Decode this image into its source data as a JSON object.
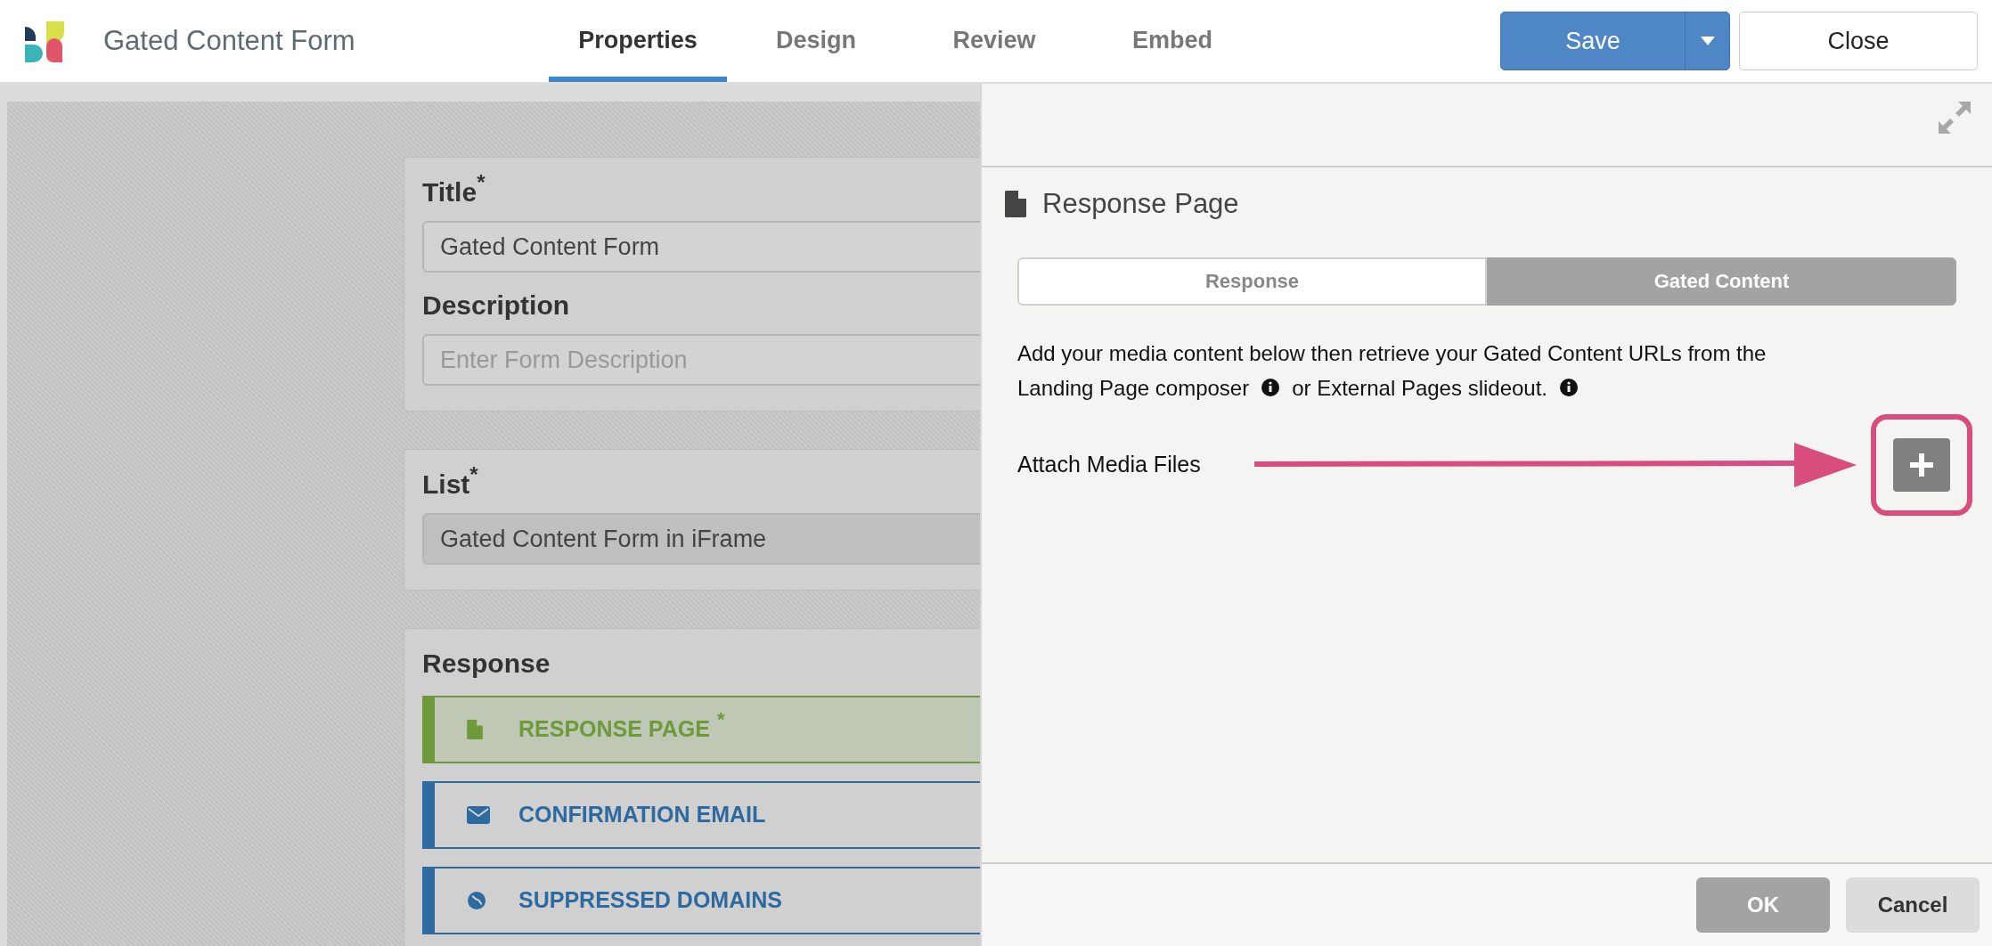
{
  "header": {
    "title": "Gated Content Form",
    "tabs": [
      {
        "label": "Properties",
        "selected": true
      },
      {
        "label": "Design",
        "selected": false
      },
      {
        "label": "Review",
        "selected": false
      },
      {
        "label": "Embed",
        "selected": false
      }
    ],
    "save": "Save",
    "close": "Close"
  },
  "form": {
    "cards": [
      {
        "kind": "fields",
        "fields": [
          {
            "label": "Title",
            "required_mark": "*",
            "value": "Gated Content Form",
            "disabled": false
          },
          {
            "label": "Description",
            "placeholder": "Enter Form Description",
            "disabled": false
          }
        ]
      },
      {
        "kind": "fields",
        "fields": [
          {
            "label": "List",
            "required_mark": "*",
            "value": "Gated Content Form in iFrame",
            "disabled": true
          }
        ]
      },
      {
        "kind": "items",
        "title": "Response",
        "items": [
          {
            "label": "RESPONSE PAGE",
            "required_mark": "*",
            "kind": "page",
            "color": "#6e9a3c",
            "selected": true
          },
          {
            "label": "CONFIRMATION EMAIL",
            "kind": "email",
            "color": "#2c6aa0",
            "selected": false
          },
          {
            "label": "SUPPRESSED DOMAINS",
            "kind": "domains",
            "color": "#2c6aa0",
            "selected": false
          }
        ]
      }
    ]
  },
  "panel": {
    "title": "Response Page",
    "segments": [
      {
        "label": "Response",
        "selected": false
      },
      {
        "label": "Gated Content",
        "selected": true
      }
    ],
    "description": [
      [
        {
          "kind": "text",
          "text": "Add your media content below then retrieve your Gated Content URLs from the"
        }
      ],
      [
        {
          "kind": "text",
          "text": "Landing Page composer"
        },
        {
          "kind": "info"
        },
        {
          "kind": "text",
          "text": "or External Pages slideout."
        },
        {
          "kind": "info"
        }
      ]
    ],
    "attach_label": "Attach Media Files",
    "attach_highlighted": true,
    "ok": "OK",
    "cancel": "Cancel"
  }
}
